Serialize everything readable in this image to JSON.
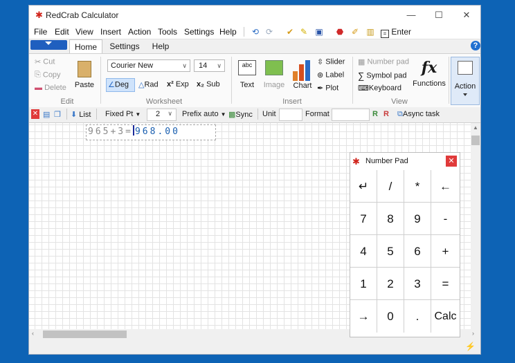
{
  "window": {
    "title": "RedCrab Calculator",
    "controls": {
      "minimize": "—",
      "maximize": "☐",
      "close": "✕"
    }
  },
  "menu": [
    "File",
    "Edit",
    "View",
    "Insert",
    "Action",
    "Tools",
    "Settings",
    "Help"
  ],
  "quick_toolbar": {
    "enter_label": "Enter"
  },
  "ribbon_tabs": [
    "Home",
    "Settings",
    "Help"
  ],
  "ribbon": {
    "edit": {
      "cut": "Cut",
      "copy": "Copy",
      "delete": "Delete",
      "paste": "Paste",
      "group": "Edit"
    },
    "worksheet": {
      "font": "Courier New",
      "size": "14",
      "deg": "Deg",
      "rad": "Rad",
      "exp": "Exp",
      "sub": "Sub",
      "group": "Worksheet"
    },
    "insert": {
      "text": "Text",
      "image": "Image",
      "chart": "Chart",
      "slider": "Slider",
      "label": "Label",
      "plot": "Plot",
      "group": "Insert"
    },
    "view": {
      "number_pad": "Number pad",
      "symbol_pad": "Symbol pad",
      "keyboard": "Keyboard",
      "functions": "Functions",
      "group": "View"
    },
    "action": {
      "label": "Action"
    }
  },
  "format_toolbar": {
    "list": "List",
    "fixed_pt": "Fixed Pt",
    "decimals": "2",
    "prefix": "Prefix auto",
    "sync": "Sync",
    "unit": "Unit",
    "format": "Format",
    "async_task": "Async task"
  },
  "worksheet": {
    "expression": "965+3=",
    "result": "968.00"
  },
  "number_pad": {
    "title": "Number Pad",
    "keys": [
      [
        "↵",
        "/",
        "*",
        "←"
      ],
      [
        "7",
        "8",
        "9",
        "-"
      ],
      [
        "4",
        "5",
        "6",
        "+"
      ],
      [
        "1",
        "2",
        "3",
        "="
      ],
      [
        "→",
        "0",
        ".",
        "Calc"
      ]
    ]
  },
  "colors": {
    "desktop": "#0d63b5",
    "accent": "#1f5fbf",
    "close_red": "#e03a3a"
  }
}
